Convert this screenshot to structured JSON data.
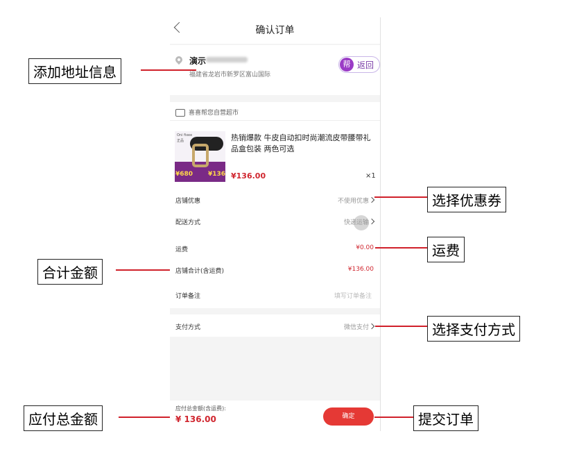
{
  "nav": {
    "title": "确认订单"
  },
  "address": {
    "name": "演示",
    "detail": "福建省龙岩市新罗区富山国际",
    "help_icon_char": "帮",
    "help_back_label": "返回"
  },
  "store": {
    "name": "喜喜帮您自营超市",
    "item": {
      "title": "热销爆款 牛皮自动扣时尚潮流皮带腰带礼品盒包装 两色可选",
      "price": "¥136.00",
      "qty": "×1",
      "thumb_brand": "Oni fixee",
      "thumb_tag": "正品",
      "thumb_price_old": "¥680",
      "thumb_price_new": "¥136"
    }
  },
  "rows": [
    {
      "label": "店铺优惠",
      "value": "不使用优惠"
    },
    {
      "label": "配送方式",
      "value": "快递运输"
    },
    {
      "label": "运费",
      "value": "¥0.00"
    },
    {
      "label": "店铺合计(含运费)",
      "value": "¥136.00"
    },
    {
      "label": "订单备注",
      "value": "填写订单备注"
    }
  ],
  "payment": {
    "label": "支付方式",
    "value": "微信支付"
  },
  "footer": {
    "total_label": "应付总金额(含运费):",
    "total_value": "¥ 136.00",
    "confirm_label": "确定"
  },
  "annotations": {
    "add_address": "添加地址信息",
    "select_coupon": "选择优惠券",
    "shipping_fee": "运费",
    "subtotal": "合计金额",
    "select_payment": "选择支付方式",
    "total_payable": "应付总金额",
    "submit_order": "提交订单"
  },
  "colors": {
    "accent": "#e53935",
    "price": "#d0262f",
    "annotation_line": "#d0202a"
  }
}
